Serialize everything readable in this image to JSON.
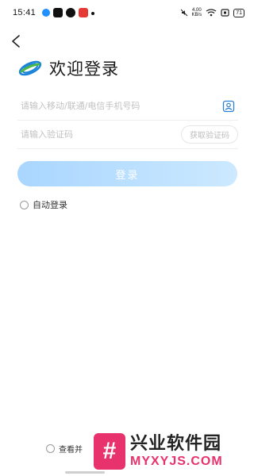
{
  "status_bar": {
    "time": "15:41",
    "net_speed_value": "4.00",
    "net_speed_unit": "KB/s",
    "battery": "71"
  },
  "header": {
    "welcome": "欢迎登录"
  },
  "form": {
    "phone_placeholder": "请输入移动/联通/电信手机号码",
    "code_placeholder": "请输入验证码",
    "get_code_label": "获取验证码",
    "login_label": "登录",
    "auto_login_label": "自动登录"
  },
  "footer": {
    "agreement_prefix": "查看并"
  },
  "watermark": {
    "badge": "#",
    "cn": "兴业软件园",
    "en": "MYXYJS.COM"
  },
  "colors": {
    "accent": "#a9d6ff",
    "logo_blue": "#1a82d8",
    "logo_green": "#4cb848",
    "watermark_pink": "#e8326d"
  }
}
